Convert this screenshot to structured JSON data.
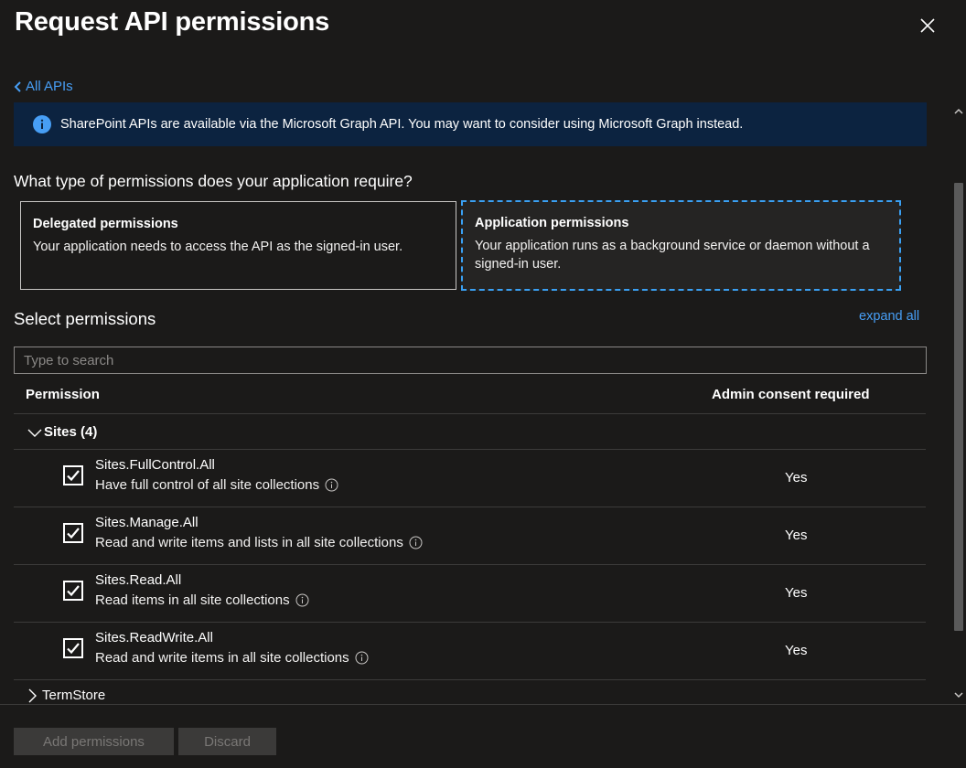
{
  "header": {
    "title": "Request API permissions"
  },
  "nav": {
    "back_label": "All APIs"
  },
  "info_bar": {
    "text": "SharePoint APIs are available via the Microsoft Graph API.  You may want to consider using Microsoft Graph instead."
  },
  "question": "What type of permissions does your application require?",
  "cards": {
    "delegated": {
      "title": "Delegated permissions",
      "desc": "Your application needs to access the API as the signed-in user."
    },
    "application": {
      "title": "Application permissions",
      "desc": "Your application runs as a background service or daemon without a signed-in user.",
      "selected": true
    }
  },
  "select": {
    "label": "Select permissions",
    "expand_all": "expand all",
    "search_placeholder": "Type to search"
  },
  "table": {
    "headers": {
      "permission": "Permission",
      "admin": "Admin consent required"
    },
    "groups": [
      {
        "name": "Sites (4)",
        "expanded": true,
        "rows": [
          {
            "name": "Sites.FullControl.All",
            "desc": "Have full control of all site collections",
            "admin": "Yes",
            "checked": true
          },
          {
            "name": "Sites.Manage.All",
            "desc": "Read and write items and lists in all site collections",
            "admin": "Yes",
            "checked": true
          },
          {
            "name": "Sites.Read.All",
            "desc": "Read items in all site collections",
            "admin": "Yes",
            "checked": true
          },
          {
            "name": "Sites.ReadWrite.All",
            "desc": "Read and write items in all site collections",
            "admin": "Yes",
            "checked": true
          }
        ]
      },
      {
        "name": "TermStore",
        "expanded": false
      }
    ]
  },
  "footer": {
    "add_label": "Add permissions",
    "discard_label": "Discard"
  },
  "colors": {
    "accent": "#479ef5",
    "info_bg": "#0c2340",
    "background": "#1b1a19",
    "selected_border": "#3aa0f3"
  }
}
